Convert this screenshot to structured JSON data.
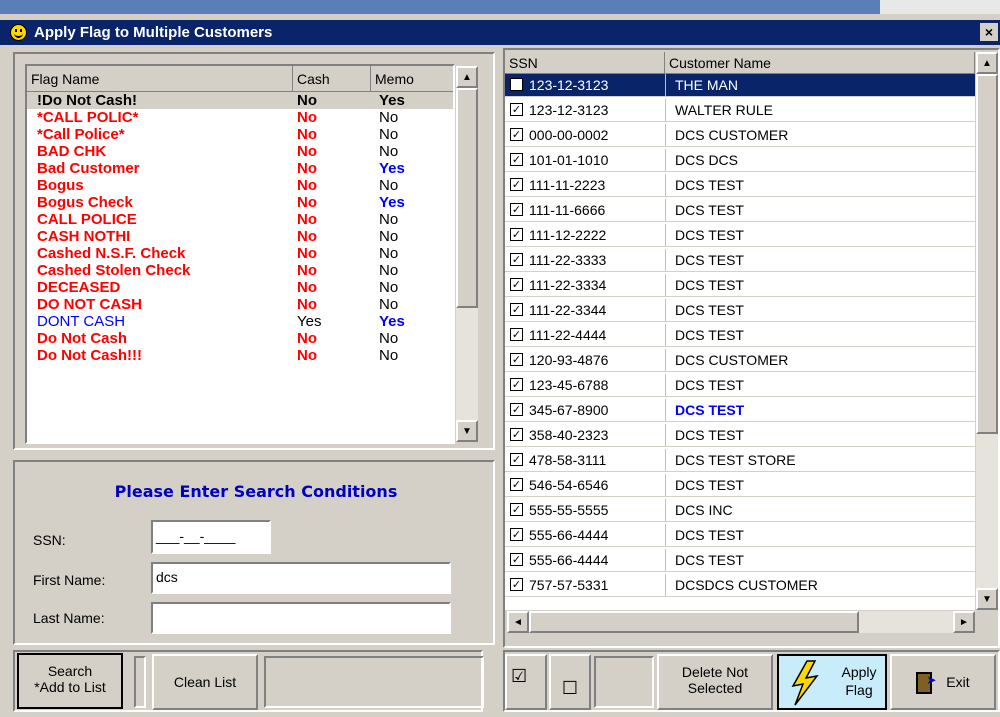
{
  "window": {
    "title": "Apply Flag to Multiple Customers",
    "close_label": "×"
  },
  "flags": {
    "headers": [
      "Flag Name",
      "Cash",
      "Memo"
    ],
    "rows": [
      {
        "name": "!Do Not Cash!",
        "cash": "No",
        "memo": "Yes",
        "name_color": "#000000",
        "cash_color": "#000000",
        "memo_color": "#000000",
        "memo_bold": true
      },
      {
        "name": "*CALL POLIC*",
        "cash": "No",
        "memo": "No",
        "name_color": "#ff0000",
        "cash_color": "#ff0000",
        "memo_color": "#000000",
        "memo_bold": false
      },
      {
        "name": "*Call Police*",
        "cash": "No",
        "memo": "No",
        "name_color": "#ff0000",
        "cash_color": "#ff0000",
        "memo_color": "#000000",
        "memo_bold": false
      },
      {
        "name": "BAD CHK",
        "cash": "No",
        "memo": "No",
        "name_color": "#ff0000",
        "cash_color": "#ff0000",
        "memo_color": "#000000",
        "memo_bold": false
      },
      {
        "name": "Bad Customer",
        "cash": "No",
        "memo": "Yes",
        "name_color": "#ff0000",
        "cash_color": "#ff0000",
        "memo_color": "#0000ff",
        "memo_bold": true
      },
      {
        "name": "Bogus",
        "cash": "No",
        "memo": "No",
        "name_color": "#ff0000",
        "cash_color": "#ff0000",
        "memo_color": "#000000",
        "memo_bold": false
      },
      {
        "name": "Bogus Check",
        "cash": "No",
        "memo": "Yes",
        "name_color": "#ff0000",
        "cash_color": "#ff0000",
        "memo_color": "#0000ff",
        "memo_bold": true
      },
      {
        "name": "CALL POLICE",
        "cash": "No",
        "memo": "No",
        "name_color": "#ff0000",
        "cash_color": "#ff0000",
        "memo_color": "#000000",
        "memo_bold": false
      },
      {
        "name": "CASH NOTHI",
        "cash": "No",
        "memo": "No",
        "name_color": "#ff0000",
        "cash_color": "#ff0000",
        "memo_color": "#000000",
        "memo_bold": false
      },
      {
        "name": "Cashed N.S.F. Check",
        "cash": "No",
        "memo": "No",
        "name_color": "#ff0000",
        "cash_color": "#ff0000",
        "memo_color": "#000000",
        "memo_bold": false
      },
      {
        "name": "Cashed Stolen Check",
        "cash": "No",
        "memo": "No",
        "name_color": "#ff0000",
        "cash_color": "#ff0000",
        "memo_color": "#000000",
        "memo_bold": false
      },
      {
        "name": "DECEASED",
        "cash": "No",
        "memo": "No",
        "name_color": "#ff0000",
        "cash_color": "#ff0000",
        "memo_color": "#000000",
        "memo_bold": false
      },
      {
        "name": "DO NOT CASH",
        "cash": "No",
        "memo": "No",
        "name_color": "#ff0000",
        "cash_color": "#ff0000",
        "memo_color": "#000000",
        "memo_bold": false
      },
      {
        "name": "DONT CASH",
        "cash": "Yes",
        "memo": "Yes",
        "name_color": "#0000ff",
        "cash_color": "#000000",
        "memo_color": "#0000ff",
        "memo_bold": true,
        "regular": true
      },
      {
        "name": "Do Not Cash",
        "cash": "No",
        "memo": "No",
        "name_color": "#ff0000",
        "cash_color": "#ff0000",
        "memo_color": "#000000",
        "memo_bold": false
      },
      {
        "name": "Do Not Cash!!!",
        "cash": "No",
        "memo": "No",
        "name_color": "#ff0000",
        "cash_color": "#ff0000",
        "memo_color": "#000000",
        "memo_bold": false
      }
    ]
  },
  "search": {
    "title": "Please Enter Search Conditions",
    "ssn_label": "SSN:",
    "ssn_value": "___-__-____",
    "first_name_label": "First Name:",
    "first_name_value": "dcs",
    "last_name_label": "Last Name:",
    "last_name_value": ""
  },
  "customers": {
    "headers": [
      "SSN",
      "Customer Name"
    ],
    "rows": [
      {
        "ssn": "123-12-3123",
        "name": "THE MAN",
        "checked": true,
        "selected": true
      },
      {
        "ssn": "123-12-3123",
        "name": "WALTER RULE",
        "checked": true
      },
      {
        "ssn": "000-00-0002",
        "name": "DCS CUSTOMER",
        "checked": true
      },
      {
        "ssn": "101-01-1010",
        "name": "DCS DCS",
        "checked": true
      },
      {
        "ssn": "111-11-2223",
        "name": "DCS TEST",
        "checked": true
      },
      {
        "ssn": "111-11-6666",
        "name": "DCS TEST",
        "checked": true
      },
      {
        "ssn": "111-12-2222",
        "name": "DCS TEST",
        "checked": true
      },
      {
        "ssn": "111-22-3333",
        "name": "DCS TEST",
        "checked": true
      },
      {
        "ssn": "111-22-3334",
        "name": "DCS TEST",
        "checked": true
      },
      {
        "ssn": "111-22-3344",
        "name": "DCS TEST",
        "checked": true
      },
      {
        "ssn": "111-22-4444",
        "name": "DCS TEST",
        "checked": true
      },
      {
        "ssn": "120-93-4876",
        "name": "DCS CUSTOMER",
        "checked": true
      },
      {
        "ssn": "123-45-6788",
        "name": "DCS TEST",
        "checked": true
      },
      {
        "ssn": "345-67-8900",
        "name": "DCS TEST",
        "checked": true,
        "highlight": true
      },
      {
        "ssn": "358-40-2323",
        "name": "DCS TEST",
        "checked": true
      },
      {
        "ssn": "478-58-3111",
        "name": "DCS TEST STORE",
        "checked": true
      },
      {
        "ssn": "546-54-6546",
        "name": "DCS TEST",
        "checked": true
      },
      {
        "ssn": "555-55-5555",
        "name": "DCS INC",
        "checked": true
      },
      {
        "ssn": "555-66-4444",
        "name": "DCS TEST",
        "checked": true
      },
      {
        "ssn": "555-66-4444",
        "name": "DCS TEST",
        "checked": true
      },
      {
        "ssn": "757-57-5331",
        "name": "DCSDCS CUSTOMER",
        "checked": true
      }
    ]
  },
  "buttons": {
    "search_line1": "Search",
    "search_line2": "*Add to List",
    "clean_list": "Clean List",
    "check_all": "☑",
    "uncheck_all": "☐",
    "delete_line1": "Delete Not",
    "delete_line2": "Selected",
    "apply_line1": "Apply",
    "apply_line2": "Flag",
    "exit": "Exit"
  },
  "colors": {
    "title_bar": "#0a246a",
    "selection": "#0a246a",
    "search_title": "#0000c0",
    "lightning": "#ffd800"
  }
}
